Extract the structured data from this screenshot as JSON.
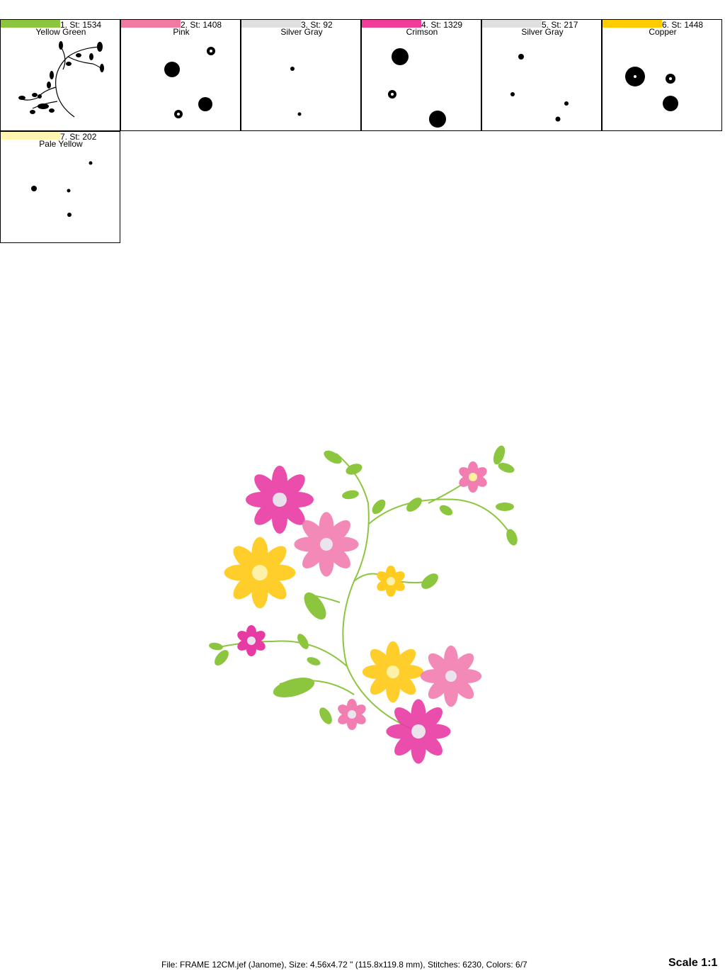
{
  "thread_blocks": [
    {
      "stitch_label": "1. St: 1534",
      "color_name": "Yellow Green",
      "color": "#8cc63f"
    },
    {
      "stitch_label": "2. St: 1408",
      "color_name": "Pink",
      "color": "#f07aa0"
    },
    {
      "stitch_label": "3. St: 92",
      "color_name": "Silver Gray",
      "color": "#e0e0e0"
    },
    {
      "stitch_label": "4. St: 1329",
      "color_name": "Crimson",
      "color": "#f23c9a"
    },
    {
      "stitch_label": "5. St: 217",
      "color_name": "Silver Gray",
      "color": "#e0e0e0"
    },
    {
      "stitch_label": "6. St: 1448",
      "color_name": "Copper",
      "color": "#ffcc00"
    },
    {
      "stitch_label": "7. St: 202",
      "color_name": "Pale Yellow",
      "color": "#fff4b0"
    }
  ],
  "footer": {
    "file_info": "File: FRAME 12CM.jef (Janome), Size: 4.56x4.72 \" (115.8x119.8 mm), Stitches: 6230, Colors: 6/7",
    "scale": "Scale 1:1"
  }
}
